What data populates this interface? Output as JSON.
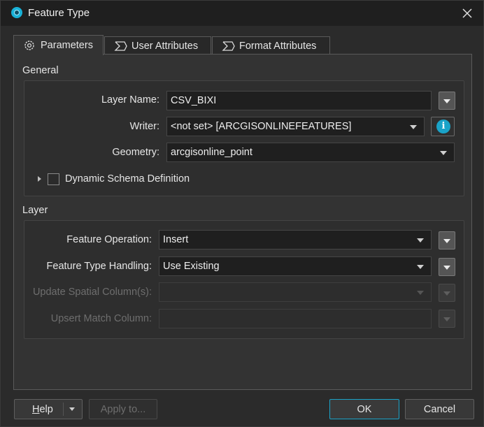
{
  "window": {
    "title": "Feature Type"
  },
  "tabs": [
    {
      "label": "Parameters",
      "icon": "gear-icon",
      "active": true
    },
    {
      "label": "User Attributes",
      "icon": "sigma-icon",
      "active": false
    },
    {
      "label": "Format Attributes",
      "icon": "sigma-icon",
      "active": false
    }
  ],
  "general": {
    "title": "General",
    "layer_name": {
      "label": "Layer Name:",
      "value": "CSV_BIXI"
    },
    "writer": {
      "label": "Writer:",
      "value": "<not set> [ARCGISONLINEFEATURES]"
    },
    "geometry": {
      "label": "Geometry:",
      "value": "arcgisonline_point"
    },
    "dynamic_schema": {
      "label": "Dynamic Schema Definition",
      "checked": false
    }
  },
  "layer": {
    "title": "Layer",
    "feature_operation": {
      "label": "Feature Operation:",
      "value": "Insert"
    },
    "feature_type_handling": {
      "label": "Feature Type Handling:",
      "value": "Use Existing"
    },
    "update_spatial_columns": {
      "label": "Update Spatial Column(s):",
      "value": ""
    },
    "upsert_match_column": {
      "label": "Upsert Match Column:",
      "value": ""
    }
  },
  "footer": {
    "help_prefix": "H",
    "help_rest": "elp",
    "apply": "Apply to...",
    "ok": "OK",
    "cancel": "Cancel"
  },
  "colors": {
    "accent": "#1aa3c8",
    "background": "#2b2b2b",
    "field": "#1f1f1f"
  }
}
